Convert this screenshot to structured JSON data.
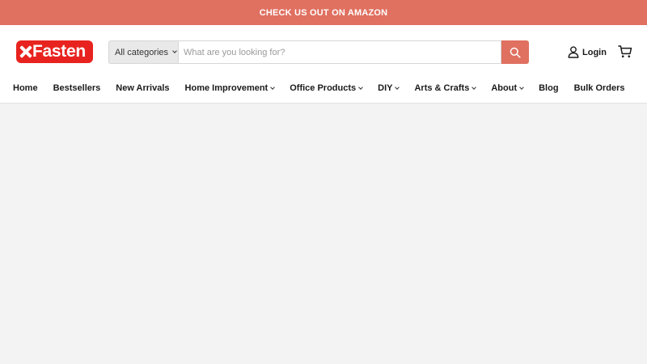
{
  "announcement": {
    "text": "CHECK US OUT ON AMAZON"
  },
  "logo": {
    "text": "Fasten",
    "full_text": "XFasten"
  },
  "search": {
    "category_label": "All categories",
    "placeholder": "What are you looking for?",
    "value": ""
  },
  "header": {
    "login_label": "Login"
  },
  "nav": {
    "items": [
      {
        "label": "Home",
        "dropdown": false
      },
      {
        "label": "Bestsellers",
        "dropdown": false
      },
      {
        "label": "New Arrivals",
        "dropdown": false
      },
      {
        "label": "Home Improvement",
        "dropdown": true
      },
      {
        "label": "Office Products",
        "dropdown": true
      },
      {
        "label": "DIY",
        "dropdown": true
      },
      {
        "label": "Arts & Crafts",
        "dropdown": true
      },
      {
        "label": "About",
        "dropdown": true
      },
      {
        "label": "Blog",
        "dropdown": false
      },
      {
        "label": "Bulk Orders",
        "dropdown": false
      }
    ]
  },
  "colors": {
    "accent": "#e07060",
    "logo_red": "#e8231f",
    "page_background": "#f3f3f3"
  },
  "icons": {
    "search": "search-icon",
    "user": "user-icon",
    "cart": "cart-icon",
    "chevron": "chevron-down-icon"
  }
}
